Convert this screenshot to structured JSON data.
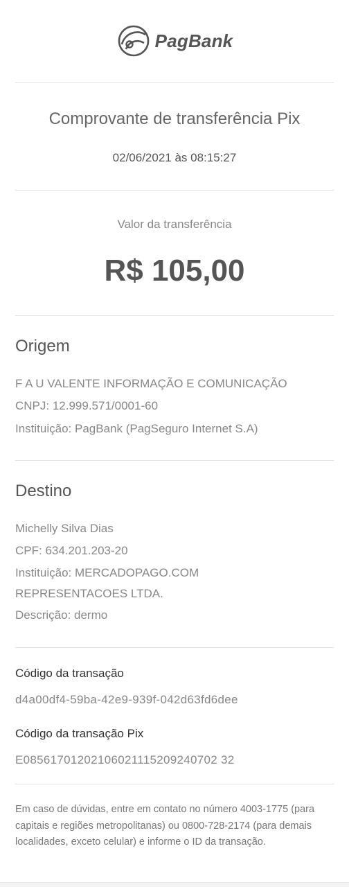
{
  "brand": {
    "name": "PagBank",
    "logo_icon": "pagbank-logo-icon"
  },
  "receipt": {
    "title": "Comprovante de transferência Pix",
    "datetime": "02/06/2021 às 08:15:27",
    "value_label": "Valor da transferência",
    "value": "R$ 105,00"
  },
  "origin": {
    "title": "Origem",
    "name": "F A U VALENTE INFORMAÇÃO E COMUNICAÇÃO",
    "doc": "CNPJ:  12.999.571/0001-60",
    "institution": "Instituição: PagBank (PagSeguro Internet S.A)"
  },
  "destination": {
    "title": "Destino",
    "name": "Michelly Silva Dias",
    "doc": "CPF:  634.201.203-20",
    "institution_line1": "Instituição: MERCADOPAGO.COM",
    "institution_line2": "REPRESENTACOES LTDA.",
    "description": "Descrição:  dermo"
  },
  "transaction": {
    "code_label": "Código da transação",
    "code": "d4a00df4-59ba-42e9-939f-042d63fd6dee",
    "pix_code_label": "Código da transação Pix",
    "pix_code": "E08561701202106021115209240702 32"
  },
  "footer": {
    "text": "Em caso de dúvidas, entre em contato no número 4003-1775 (para capitais e regiões metropolitanas) ou 0800-728-2174 (para demais localidades, exceto celular) e informe o ID da transação."
  }
}
